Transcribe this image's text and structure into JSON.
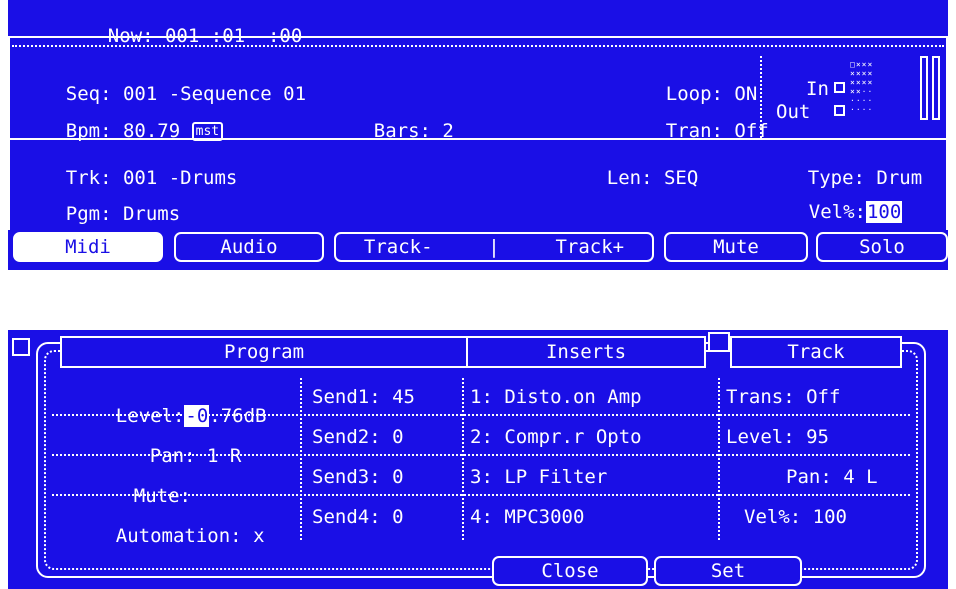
{
  "main_screen": {
    "now": {
      "label": "Now:",
      "bar": "001",
      "beat": ":01",
      "tick": ":00"
    },
    "sequence": {
      "label": "Seq:",
      "value": "001 -Sequence 01"
    },
    "loop": {
      "label": "Loop:",
      "value": "ON"
    },
    "bpm": {
      "label": "Bpm:",
      "value": "80.79",
      "tempo_source": "mst"
    },
    "bars": {
      "label": "Bars:",
      "value": "2"
    },
    "tran": {
      "label": "Tran:",
      "value": "Off"
    },
    "midi_in_label": "In",
    "midi_out_label": "Out",
    "track": {
      "label": "Trk:",
      "value": "001 -Drums"
    },
    "length": {
      "label": "Len:",
      "value": "SEQ"
    },
    "type": {
      "label": "Type:",
      "value": "Drum"
    },
    "program": {
      "label": "Pgm:",
      "value": "Drums"
    },
    "velocity": {
      "label": "Vel%:",
      "value": "100"
    },
    "buttons": {
      "midi": "Midi",
      "audio": "Audio",
      "track_minus": "Track-",
      "separator": "|",
      "track_plus": "Track+",
      "mute": "Mute",
      "solo": "Solo"
    },
    "active_tab": "Midi"
  },
  "mixer_dialog": {
    "tabs": {
      "program": "Program",
      "inserts": "Inserts",
      "track": "Track"
    },
    "program_col": {
      "level_label": "Level:",
      "level_cursor": "-0",
      "level_rest": ".76dB",
      "pan_label": "Pan:",
      "pan_value": "1 R",
      "mute_label": "Mute:",
      "automation_label": "Automation:",
      "automation_value": "x"
    },
    "sends": [
      {
        "label": "Send1:",
        "value": "45"
      },
      {
        "label": "Send2:",
        "value": "0"
      },
      {
        "label": "Send3:",
        "value": "0"
      },
      {
        "label": "Send4:",
        "value": "0"
      }
    ],
    "inserts": [
      {
        "slot": "1:",
        "name": "Disto.on Amp"
      },
      {
        "slot": "2:",
        "name": "Compr.r Opto"
      },
      {
        "slot": "3:",
        "name": "LP Filter"
      },
      {
        "slot": "4:",
        "name": "MPC3000"
      }
    ],
    "track_col": {
      "trans_label": "Trans:",
      "trans_value": "Off",
      "level_label": "Level:",
      "level_value": "95",
      "pan_label": "Pan:",
      "pan_value": "4 L",
      "vel_label": "Vel%:",
      "vel_value": "100"
    },
    "buttons": {
      "close": "Close",
      "set": "Set"
    }
  },
  "colors": {
    "screen_bg": "#1a0fe6",
    "foreground": "#ffffff",
    "page_bg": "#ffffff"
  }
}
